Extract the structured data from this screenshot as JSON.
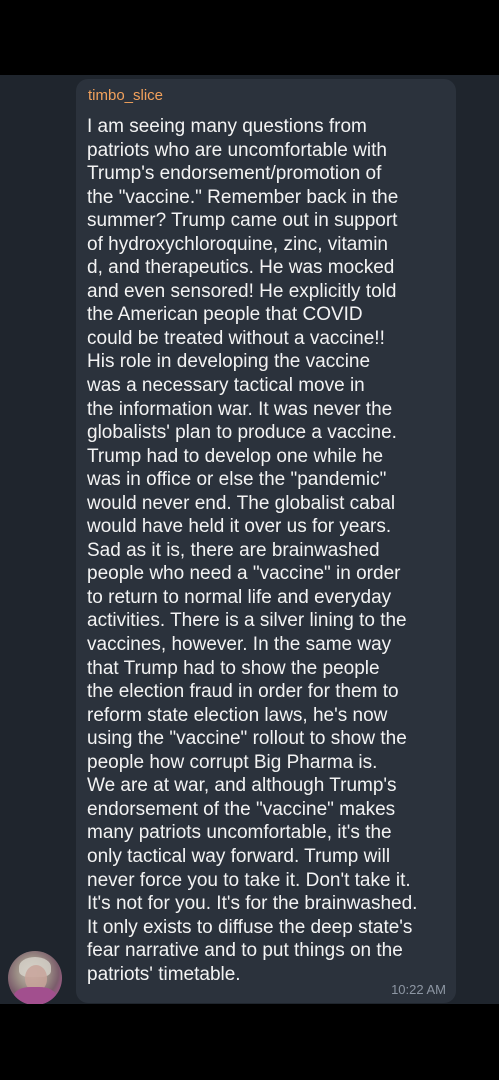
{
  "message": {
    "author": "timbo_slice",
    "time": "10:22 AM",
    "lines": [
      "I am seeing many questions from",
      "patriots who are uncomfortable with",
      "Trump's endorsement/promotion of",
      "the \"vaccine.\" Remember back in the",
      "summer? Trump came out in support",
      "of hydroxychloroquine, zinc, vitamin",
      "d, and therapeutics. He was mocked",
      "and even sensored! He explicitly told",
      "the American people that COVID",
      "could be treated without a vaccine!!",
      "His role in developing the vaccine",
      "was a necessary tactical move in",
      "the information war. It was never the",
      "globalists' plan to produce a vaccine.",
      "Trump had to develop one while he",
      "was in office or else the \"pandemic\"",
      "would never end. The globalist cabal",
      "would have held it over us for years.",
      "Sad as it is, there are brainwashed",
      "people who need a \"vaccine\" in order",
      "to return to normal life and everyday",
      "activities. There is a silver lining to the",
      "vaccines, however. In the same way",
      "that Trump had to show the people",
      "the election fraud in order for them to",
      "reform state election laws, he's now",
      "using the \"vaccine\" rollout to show the",
      "people how corrupt Big Pharma is.",
      "We are at war, and although Trump's",
      "endorsement of the \"vaccine\" makes",
      "many patriots uncomfortable, it's the",
      "only tactical way forward. Trump will",
      "never force you to take it. Don't take it.",
      "It's not for you. It's for the brainwashed.",
      "It only exists to diffuse the deep state's",
      "fear narrative and to put things on the",
      "patriots' timetable."
    ]
  },
  "colors": {
    "author": "#f2a15c",
    "bubble": "#2b323c",
    "background": "#1f252d"
  }
}
